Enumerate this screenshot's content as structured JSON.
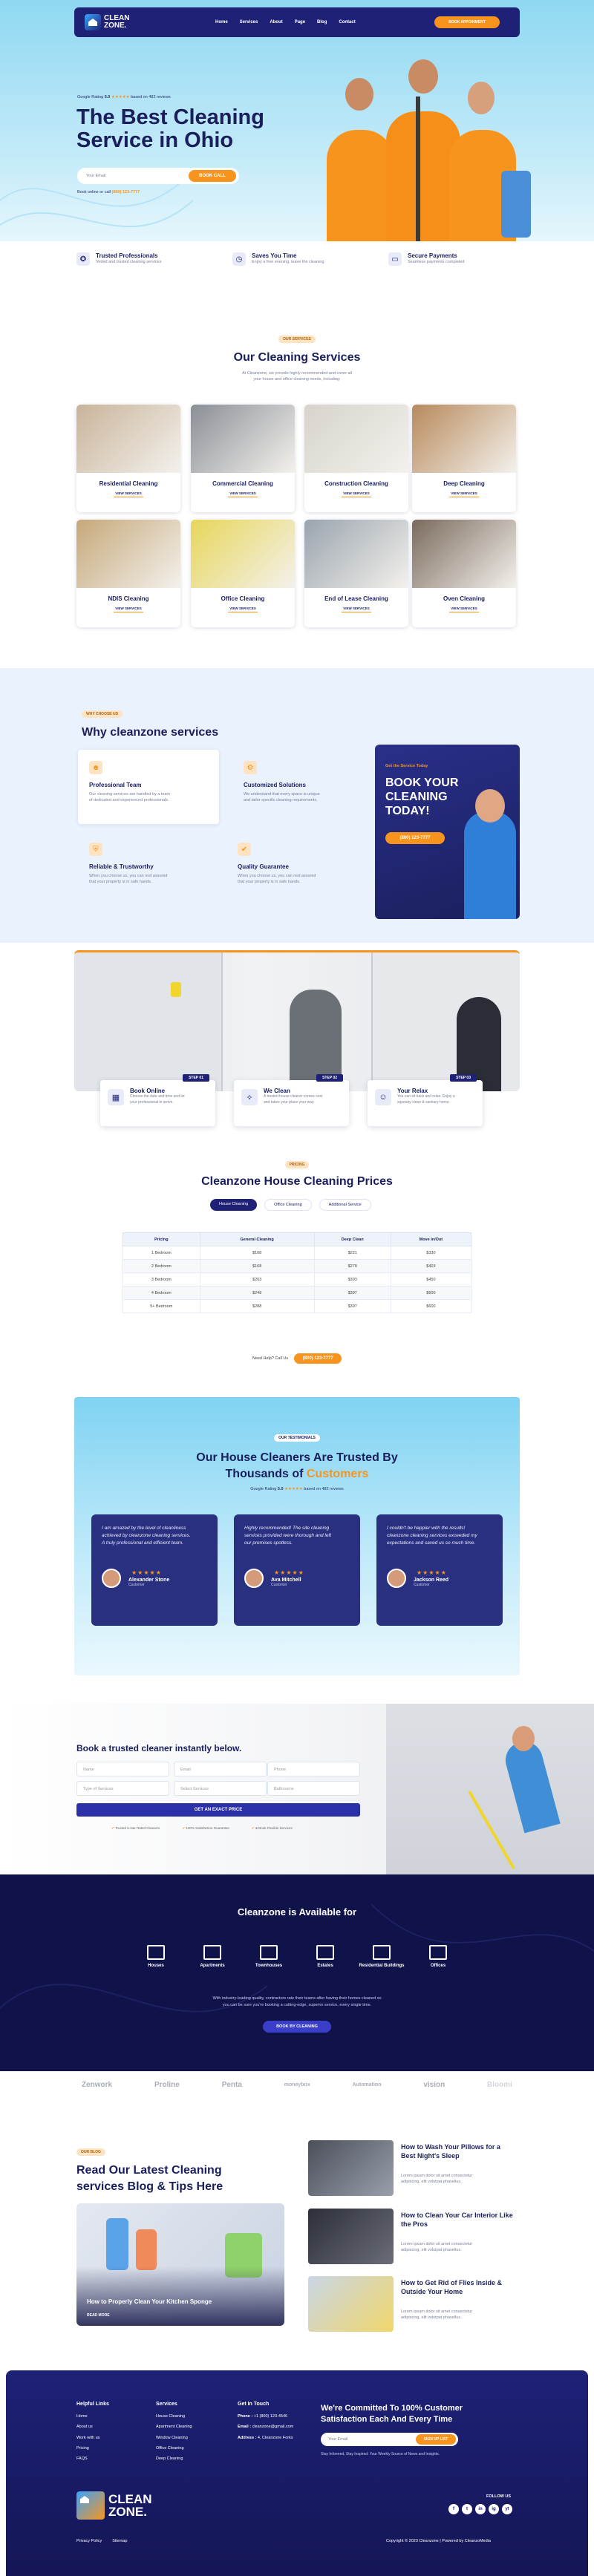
{
  "brand": {
    "name_line1": "CLEAN",
    "name_line2": "ZONE."
  },
  "nav": {
    "links": [
      "Home",
      "Services",
      "About",
      "Page",
      "Blog",
      "Contact"
    ],
    "cta": "BOOK APPOINMENT"
  },
  "hero": {
    "rating_prefix": "Google Rating",
    "rating_value": "5.0",
    "rating_suffix": "based on 482 reviews",
    "title_line1": "The Best Cleaning",
    "title_line2": "Service in Ohio",
    "input_placeholder": "Your Email",
    "cta": "BOOK CALL",
    "phone_prefix": "Book online or call",
    "phone": "(800) 123-7777"
  },
  "features": [
    {
      "icon": "medal-icon",
      "title": "Trusted Professionals",
      "desc": "Vetted and trusted cleaning services"
    },
    {
      "icon": "clock-icon",
      "title": "Saves You Time",
      "desc": "Enjoy a free evening, leave the cleaning"
    },
    {
      "icon": "card-icon",
      "title": "Secure Payments",
      "desc": "Seamless payments completed"
    }
  ],
  "services": {
    "pill": "OUR SERVICES",
    "title": "Our Cleaning Services",
    "desc_line1": "At Cleanzone, we provide highly recommended and cover all",
    "desc_line2": "your house and office cleaning needs, including:",
    "view_label": "VIEW SERVICES",
    "items": [
      {
        "title": "Residential Cleaning",
        "color": "#c9b49a"
      },
      {
        "title": "Commercial Cleaning",
        "color": "#8a8f96"
      },
      {
        "title": "Construction Cleaning",
        "color": "#d7d3cc"
      },
      {
        "title": "Deep Cleaning",
        "color": "#b88a5c"
      },
      {
        "title": "NDIS Cleaning",
        "color": "#c6a87a"
      },
      {
        "title": "Office Cleaning",
        "color": "#e7d65a"
      },
      {
        "title": "End of Lease Cleaning",
        "color": "#9aa4ae"
      },
      {
        "title": "Oven Cleaning",
        "color": "#7a6a5c"
      }
    ]
  },
  "why": {
    "pill": "WHY CHOOSE US",
    "title": "Why cleanzone services",
    "items": [
      {
        "icon": "team-icon",
        "title": "Professional Team",
        "desc_line1": "Our cleaning services are handled by a team",
        "desc_line2": "of dedicated and experienced professionals."
      },
      {
        "icon": "solutions-icon",
        "title": "Customized Solutions",
        "desc_line1": "We understand that every space is unique",
        "desc_line2": "and tailor specific cleaning requirements."
      },
      {
        "icon": "trust-icon",
        "title": "Reliable & Trustworthy",
        "desc_line1": "When you choose us, you can rest assured",
        "desc_line2": "that your property is in safe hands."
      },
      {
        "icon": "guarantee-icon",
        "title": "Quality Guarantee",
        "desc_line1": "When you choose us, you can rest assured",
        "desc_line2": "that your property is in safe hands."
      }
    ],
    "promo": {
      "kicker": "Get the Service Today",
      "title_line1": "BOOK YOUR",
      "title_line2": "CLEANING",
      "title_line3": "TODAY!",
      "cta": "(800) 123-7777"
    }
  },
  "steps": [
    {
      "badge": "STEP 01",
      "icon": "calendar-icon",
      "title": "Book Online",
      "desc_line1": "Choose the date and time and let",
      "desc_line2": "your professional in arrive."
    },
    {
      "badge": "STEP 02",
      "icon": "clean-icon",
      "title": "We Clean",
      "desc_line1": "A trusted house cleaner comes over",
      "desc_line2": "and takes your place your way."
    },
    {
      "badge": "STEP 03",
      "icon": "relax-icon",
      "title": "Your Relax",
      "desc_line1": "You can sit back and relax. Enjoy a",
      "desc_line2": "squeaky clean & sanitary home."
    }
  ],
  "pricing": {
    "pill": "PRICING",
    "title": "Cleanzone House Cleaning Prices",
    "tabs": [
      "House Cleaning",
      "Office Cleaning",
      "Additional Service"
    ],
    "headers": [
      "Pricing",
      "General Cleaning",
      "Deep Clean",
      "Move In/Out"
    ],
    "rows": [
      [
        "1 Bedroom",
        "$108",
        "$221",
        "$330"
      ],
      [
        "2 Bedroom",
        "$168",
        "$270",
        "$403"
      ],
      [
        "3 Bedroom",
        "$203",
        "$303",
        "$450"
      ],
      [
        "4 Bedroom",
        "$248",
        "$397",
        "$600"
      ],
      [
        "5+ Bedroom",
        "$288",
        "$397",
        "$600"
      ]
    ],
    "need_help": "Need Help? Call Us",
    "phone": "(800) 123-7777"
  },
  "testimonials": {
    "pill": "OUR TESTIMONIALS",
    "title_line1": "Our House Cleaners Are Trusted By",
    "title_line2_a": "Thousands of",
    "title_line2_b": "Customers",
    "rating_prefix": "Google Rating",
    "rating_value": "5.0",
    "rating_suffix": "based on 482 reviews",
    "stars": "★★★★★",
    "items": [
      {
        "quote_line1": "I am amazed by the level of cleanliness",
        "quote_line2": "achieved by cleanzone cleaning services.",
        "quote_line3": "A truly professional and efficient team.",
        "name": "Alexander Stone",
        "role": "Customer"
      },
      {
        "quote_line1": "Highly recommended! The site cleaning",
        "quote_line2": "services provided were thorough and left",
        "quote_line3": "our premises spotless.",
        "name": "Ava Mitchell",
        "role": "Customer"
      },
      {
        "quote_line1": "I couldn't be happier with the results!",
        "quote_line2": "cleanzone cleaning services exceeded my",
        "quote_line3": "expectations and saved us so much time.",
        "name": "Jackson Reed",
        "role": "Customer"
      }
    ]
  },
  "booking": {
    "title": "Book a trusted cleaner instantly below.",
    "fields": [
      "Name",
      "Email",
      "Phone",
      "Type of Services",
      "Select Services",
      "Bathrooms"
    ],
    "cta": "GET AN EXACT PRICE",
    "badges": [
      "Trusted 5-star Rated Cleaners",
      "100% Satisfaction Guarantee",
      "& Book Flexible Services"
    ]
  },
  "available": {
    "title": "Cleanzone is Available for",
    "types": [
      {
        "icon": "house-icon",
        "label": "Houses"
      },
      {
        "icon": "apartment-icon",
        "label": "Apartments"
      },
      {
        "icon": "townhouse-icon",
        "label": "Townhouses"
      },
      {
        "icon": "estate-icon",
        "label": "Estates"
      },
      {
        "icon": "residential-icon",
        "label": "Residential Buildings"
      },
      {
        "icon": "office-icon",
        "label": "Offices"
      }
    ],
    "desc_line1": "With industry-leading quality, contractors rate their teams after having their homes cleaned so",
    "desc_line2": "you can be sure you're booking a cutting-edge, superior service, every single time.",
    "cta": "BOOK BY CLEANING"
  },
  "partners": [
    "Zenwork",
    "Proline",
    "Penta",
    "moneybox",
    "Automation",
    "vision",
    "Bloomi"
  ],
  "blog": {
    "pill": "OUR BLOG",
    "title_line1": "Read Our Latest Cleaning",
    "title_line2": "services Blog & Tips Here",
    "featured_title": "How to Properly Clean Your Kitchen Sponge",
    "featured_more": "READ MORE",
    "posts": [
      {
        "title_line1": "How to Wash Your Pillows for a",
        "title_line2": "Best Night's Sleep",
        "desc_line1": "Lorem ipsum dolor sit amet consectetur",
        "desc_line2": "adipiscing, elit volutpat phasellus."
      },
      {
        "title_line1": "How to Clean Your Car Interior Like",
        "title_line2": "the Pros",
        "desc_line1": "Lorem ipsum dolor sit amet consectetur",
        "desc_line2": "adipiscing, elit volutpat phasellus."
      },
      {
        "title_line1": "How to Get Rid of Flies Inside &",
        "title_line2": "Outside Your Home",
        "desc_line1": "Lorem ipsum dolor sit amet consectetur",
        "desc_line2": "adipiscing, elit volutpat phasellus."
      }
    ]
  },
  "footer": {
    "col1": {
      "title": "Helpful Links",
      "links": [
        "Home",
        "About us",
        "Work with us",
        "Pricing",
        "FAQS"
      ]
    },
    "col2": {
      "title": "Services",
      "links": [
        "House Cleaning",
        "Apartment Cleaning",
        "Window Cleaning",
        "Office Cleaning",
        "Deep Cleaning"
      ]
    },
    "col3": {
      "title": "Get In Touch",
      "phone_label": "Phone :",
      "phone": "+1 (800) 123-4546",
      "email_label": "Email :",
      "email": "cleanzone@gmail.com",
      "address_label": "Address :",
      "address": "4, Cleanzone Forks"
    },
    "commit_line1": "We're Committed To 100% Customer",
    "commit_line2": "Satisfaction Each And Every Time",
    "input_placeholder": "Your Email",
    "subscribe": "SIGN UP LIST",
    "note": "Stay Informed, Stay Inspired: Your Weekly Source of News and Insights.",
    "follow": "FOLLOW US",
    "social": [
      "f",
      "t",
      "in",
      "ig",
      "yt"
    ],
    "bottom_links": [
      "Privacy Policy",
      "Sitemap"
    ],
    "copyright": "Copyright © 2023 Cleanzone | Powered by CleanzoMedia"
  }
}
